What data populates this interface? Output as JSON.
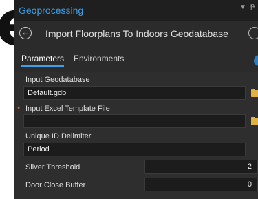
{
  "background_text": "e",
  "panel": {
    "title": "Geoprocessing",
    "pin_icon": "pin-icon",
    "dropdown_icon": "dropdown-icon"
  },
  "tool": {
    "title": "Import Floorplans To Indoors Geodatabase"
  },
  "tabs": [
    {
      "label": "Parameters"
    },
    {
      "label": "Environments"
    }
  ],
  "params": {
    "input_geodatabase": {
      "label": "Input Geodatabase",
      "value": "Default.gdb"
    },
    "input_excel": {
      "label": "Input Excel Template File",
      "value": "",
      "required_mark": "*"
    },
    "unique_id": {
      "label": "Unique ID Delimiter",
      "value": "Period"
    },
    "sliver": {
      "label": "Sliver Threshold",
      "value": "2"
    },
    "door_close": {
      "label": "Door Close Buffer",
      "value": "0"
    }
  },
  "colors": {
    "accent": "#3ba0e8",
    "required": "#e8742f",
    "folder": "#e0b143"
  }
}
